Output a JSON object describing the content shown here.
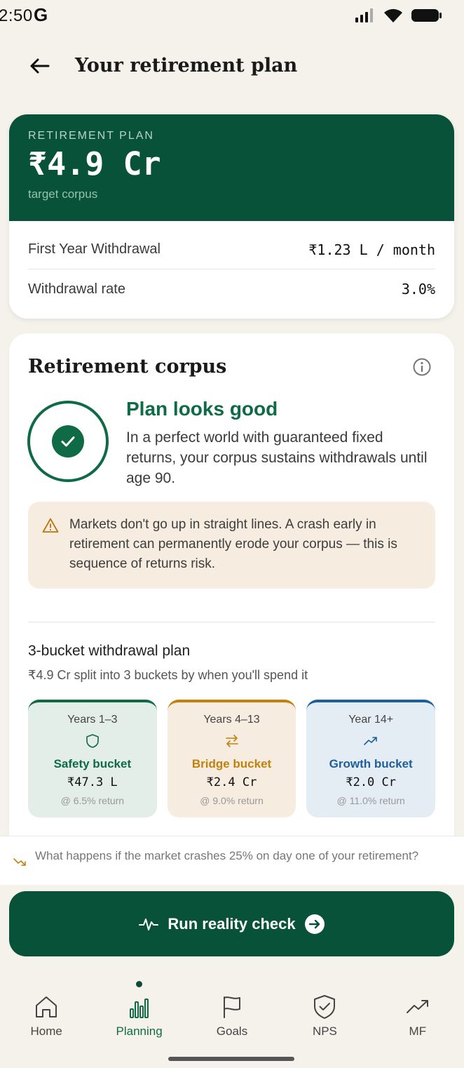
{
  "status_bar": {
    "time": "2:50",
    "g_logo": "G",
    "icons": [
      "signal-icon",
      "wifi-icon",
      "battery-icon"
    ]
  },
  "header": {
    "title": "Your retirement plan",
    "back_icon": "arrow-left-icon"
  },
  "plan": {
    "eyebrow": "RETIREMENT PLAN",
    "amount": "₹4.9 Cr",
    "sub": "target corpus",
    "first_year_label": "First Year Withdrawal",
    "first_year_value": "₹1.23 L / month",
    "rate_label": "Withdrawal rate",
    "rate_value": "3.0%"
  },
  "corpus": {
    "title": "Retirement corpus",
    "status_heading": "Plan looks good",
    "status_text": "In a perfect world with guaranteed fixed returns, your corpus sustains withdrawals until age 90.",
    "warning": "Markets don't go up in straight lines. A crash early in retirement can permanently erode your corpus — this is sequence of returns risk.",
    "bucket_title": "3-bucket withdrawal plan",
    "bucket_sub": "₹4.9 Cr split into 3 buckets by when you'll spend it",
    "buckets": [
      {
        "years": "Years 1–3",
        "name": "Safety bucket",
        "amount": "₹47.3 L",
        "return": "@ 6.5% return",
        "icon": "shield-icon"
      },
      {
        "years": "Years 4–13",
        "name": "Bridge bucket",
        "amount": "₹2.4 Cr",
        "return": "@ 9.0% return",
        "icon": "swap-arrows-icon"
      },
      {
        "years": "Year 14+",
        "name": "Growth bucket",
        "amount": "₹2.0 Cr",
        "return": "@ 11.0% return",
        "icon": "trend-up-icon"
      }
    ]
  },
  "crash_hint": "What happens if the market crashes 25% on day one of your retirement?",
  "cta": {
    "label": "Run reality check"
  },
  "nav": [
    {
      "label": "Home",
      "icon": "home-icon"
    },
    {
      "label": "Planning",
      "icon": "bar-chart-icon",
      "active": true
    },
    {
      "label": "Goals",
      "icon": "flag-icon"
    },
    {
      "label": "NPS",
      "icon": "shield-check-icon"
    },
    {
      "label": "MF",
      "icon": "trend-up-icon"
    }
  ],
  "colors": {
    "brand_green": "#075238",
    "accent_green": "#0e6b45",
    "bridge_amber": "#c4800d",
    "growth_blue": "#1d5f9e",
    "background": "#f5f2ec"
  }
}
